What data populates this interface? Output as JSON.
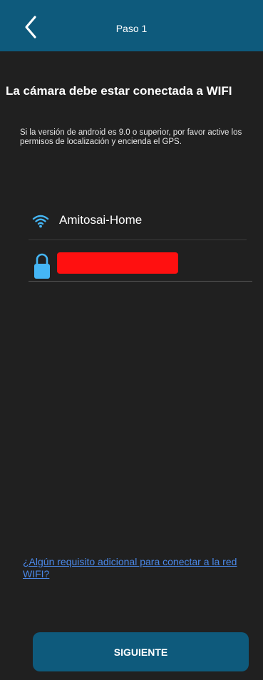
{
  "app_bar": {
    "title": "Paso 1",
    "back_icon": "chevron-left-icon"
  },
  "heading": "La cámara debe estar conectada a WIFI",
  "description": "Si la versión de android es 9.0 o superior, por favor active los permisos de localización y encienda el GPS.",
  "wifi": {
    "icon": "wifi-icon",
    "network_name": "Amitosai-Home"
  },
  "password": {
    "icon": "lock-icon",
    "value": ""
  },
  "help_link": "¿Algún requisito adicional para conectar a la red WIFI?",
  "next_button": "SIGUIENTE",
  "colors": {
    "primary": "#0e5a7c",
    "background": "#202020",
    "link": "#4a88e8",
    "wifi_icon": "#45b6f5",
    "lock_icon": "#45b6f5",
    "redaction": "#ff1010"
  }
}
